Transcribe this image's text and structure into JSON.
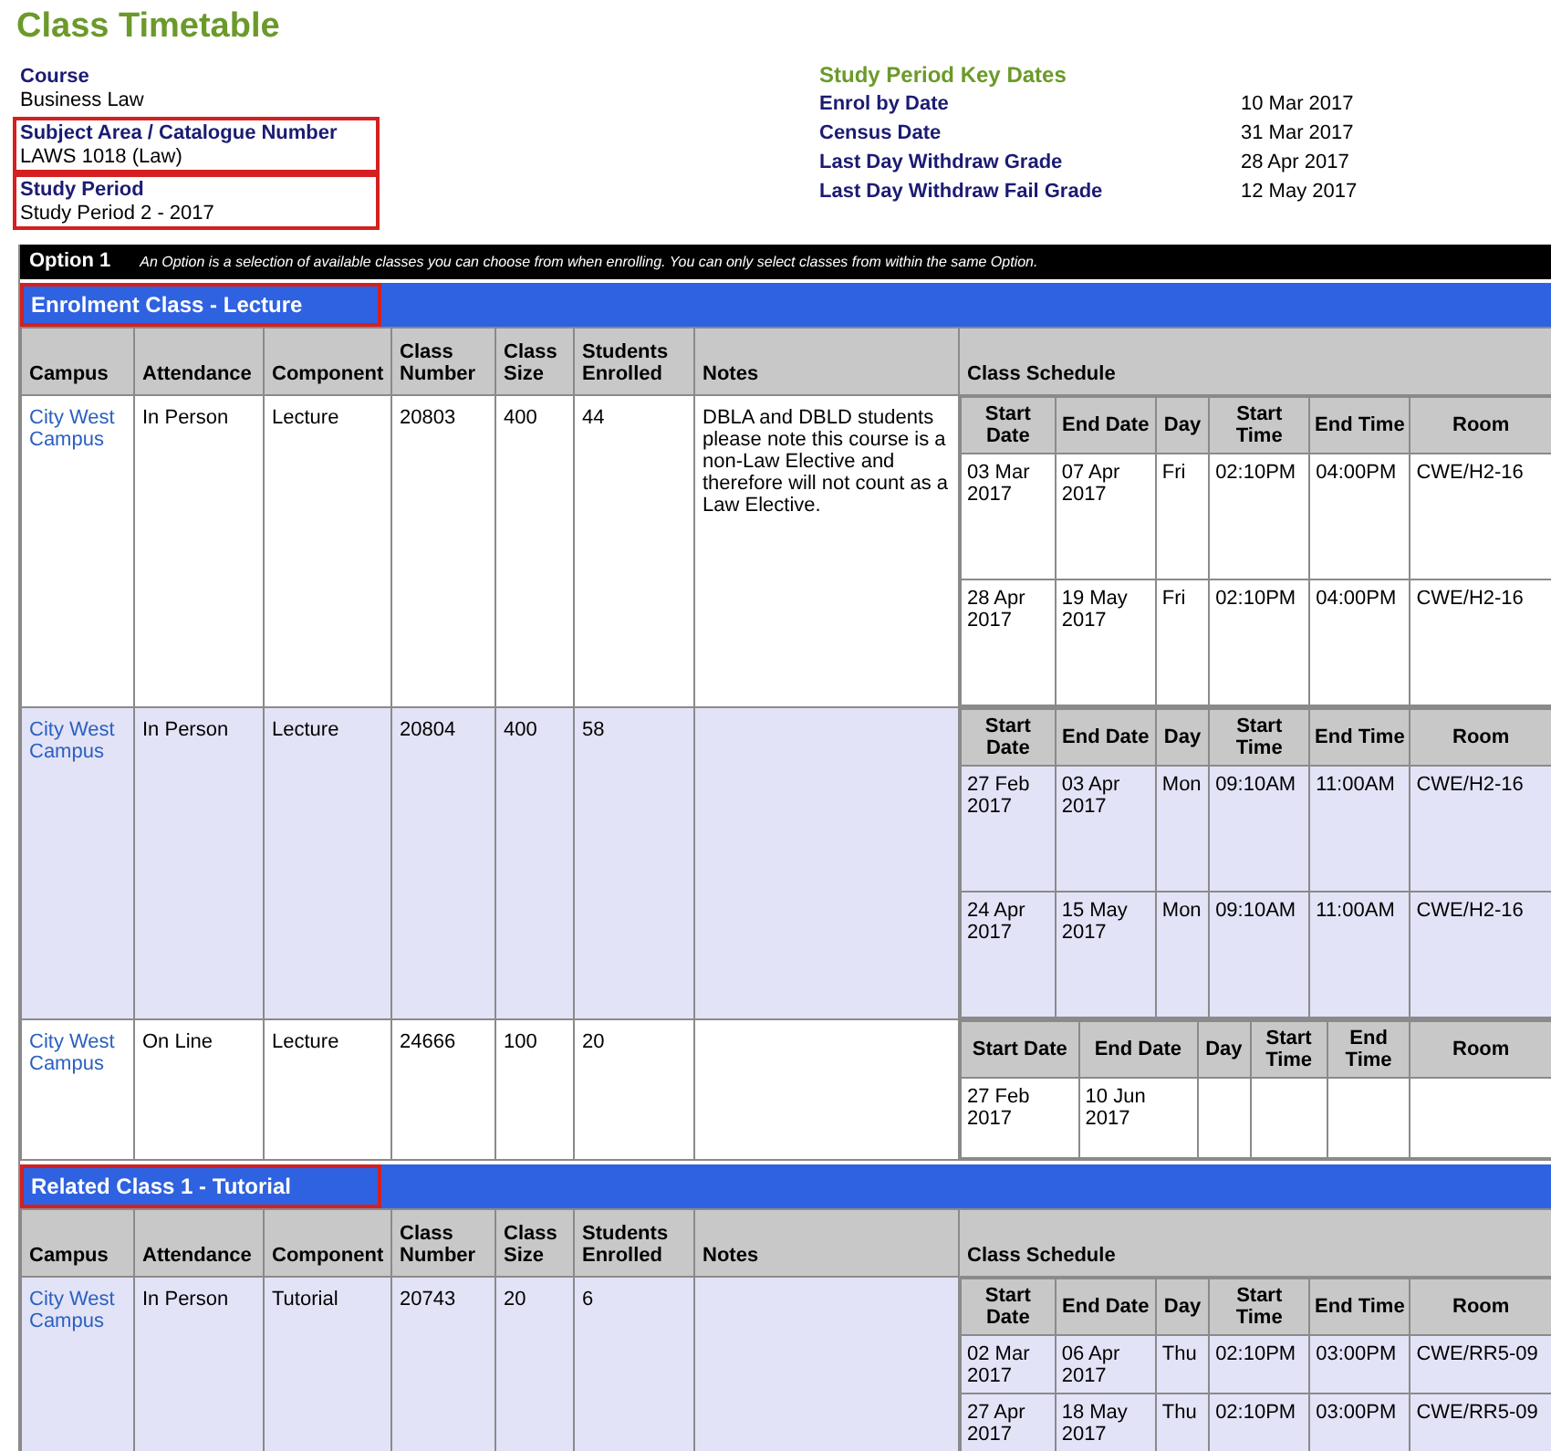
{
  "title": "Class Timetable",
  "details": [
    {
      "label": "Course",
      "value": "Business Law",
      "highlighted": false
    },
    {
      "label": "Subject Area / Catalogue Number",
      "value": "LAWS 1018 (Law)",
      "highlighted": true
    },
    {
      "label": "Study Period",
      "value": "Study Period 2 - 2017",
      "highlighted": true
    }
  ],
  "key_dates": {
    "title": "Study Period Key Dates",
    "items": [
      {
        "label": "Enrol by Date",
        "value": "10 Mar 2017"
      },
      {
        "label": "Census Date",
        "value": "31 Mar 2017"
      },
      {
        "label": "Last Day Withdraw Grade",
        "value": "28 Apr 2017"
      },
      {
        "label": "Last Day Withdraw Fail Grade",
        "value": "12 May 2017"
      }
    ]
  },
  "option": {
    "label": "Option 1",
    "note": "An Option is a selection of available classes you can choose from when enrolling. You can only select classes from within the same Option."
  },
  "sections": [
    {
      "title": "Enrolment Class - Lecture",
      "highlighted": true,
      "columns": [
        "Campus",
        "Attendance",
        "Component",
        "Class Number",
        "Class Size",
        "Students Enrolled",
        "Notes",
        "Class Schedule"
      ],
      "rows": [
        {
          "campus": "City West Campus",
          "attendance": "In Person",
          "component": "Lecture",
          "class_number": "20803",
          "class_size": "400",
          "enrolled": "44",
          "notes": "DBLA and DBLD students please note this course is a non-Law Elective and therefore will not count as a Law Elective.",
          "shaded": false,
          "schedule_columns": [
            "Start Date",
            "End Date",
            "Day",
            "Start Time",
            "End Time",
            "Room"
          ],
          "schedule": [
            {
              "start_date": "03 Mar 2017",
              "end_date": "07 Apr 2017",
              "day": "Fri",
              "start_time": "02:10PM",
              "end_time": "04:00PM",
              "room": "CWE/H2-16"
            },
            {
              "start_date": "28 Apr 2017",
              "end_date": "19 May 2017",
              "day": "Fri",
              "start_time": "02:10PM",
              "end_time": "04:00PM",
              "room": "CWE/H2-16"
            }
          ]
        },
        {
          "campus": "City West Campus",
          "attendance": "In Person",
          "component": "Lecture",
          "class_number": "20804",
          "class_size": "400",
          "enrolled": "58",
          "shaded": true,
          "schedule_columns": [
            "Start Date",
            "End Date",
            "Day",
            "Start Time",
            "End Time",
            "Room"
          ],
          "schedule": [
            {
              "start_date": "27 Feb 2017",
              "end_date": "03 Apr 2017",
              "day": "Mon",
              "start_time": "09:10AM",
              "end_time": "11:00AM",
              "room": "CWE/H2-16"
            },
            {
              "start_date": "24 Apr 2017",
              "end_date": "15 May 2017",
              "day": "Mon",
              "start_time": "09:10AM",
              "end_time": "11:00AM",
              "room": "CWE/H2-16"
            }
          ]
        },
        {
          "campus": "City West Campus",
          "attendance": "On Line",
          "component": "Lecture",
          "class_number": "24666",
          "class_size": "100",
          "enrolled": "20",
          "shaded": false,
          "schedule_columns": [
            "Start Date",
            "End Date",
            "Day",
            "Start Time",
            "End Time",
            "Room"
          ],
          "schedule": [
            {
              "start_date": "27 Feb 2017",
              "end_date": "10 Jun 2017"
            }
          ]
        }
      ]
    },
    {
      "title": "Related Class 1 - Tutorial",
      "highlighted": true,
      "columns": [
        "Campus",
        "Attendance",
        "Component",
        "Class Number",
        "Class Size",
        "Students Enrolled",
        "Notes",
        "Class Schedule"
      ],
      "rows": [
        {
          "campus": "City West Campus",
          "attendance": "In Person",
          "component": "Tutorial",
          "class_number": "20743",
          "class_size": "20",
          "enrolled": "6",
          "shaded": true,
          "schedule_columns": [
            "Start Date",
            "End Date",
            "Day",
            "Start Time",
            "End Time",
            "Room"
          ],
          "schedule": [
            {
              "start_date": "02 Mar 2017",
              "end_date": "06 Apr 2017",
              "day": "Thu",
              "start_time": "02:10PM",
              "end_time": "03:00PM",
              "room": "CWE/RR5-09"
            },
            {
              "start_date": "27 Apr 2017",
              "end_date": "18 May 2017",
              "day": "Thu",
              "start_time": "02:10PM",
              "end_time": "03:00PM",
              "room": "CWE/RR5-09"
            }
          ]
        }
      ]
    }
  ]
}
